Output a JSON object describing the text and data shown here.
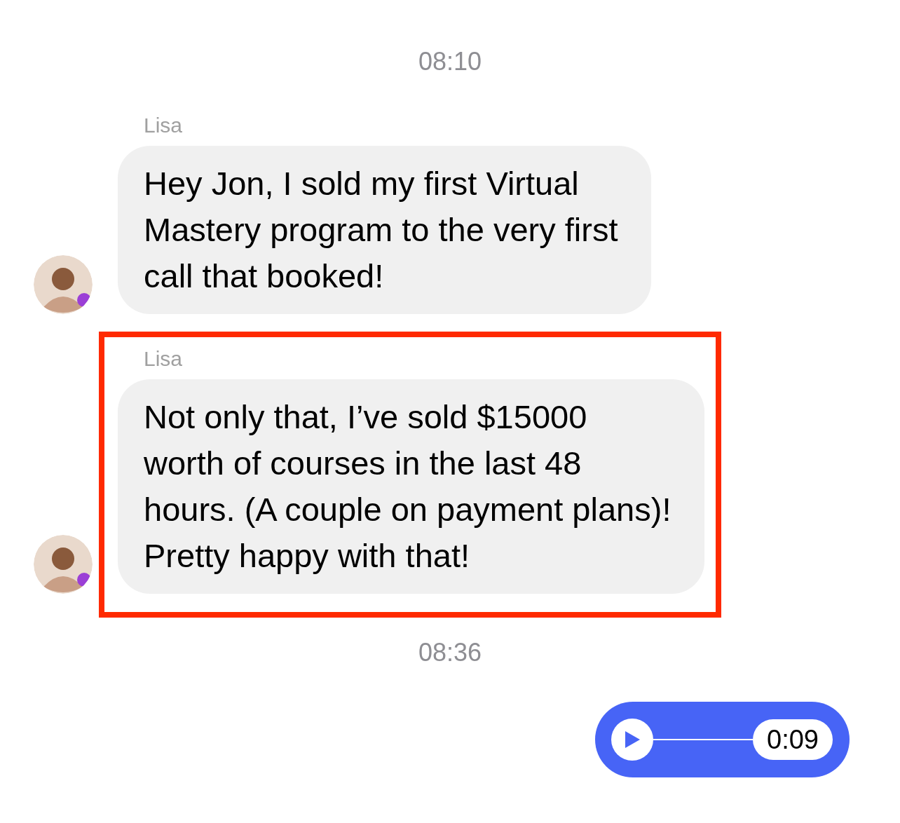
{
  "items": [
    {
      "kind": "timestamp",
      "text": "08:10"
    },
    {
      "kind": "incoming",
      "sender": "Lisa",
      "text": "Hey Jon, I sold my first Virtual\nMastery program to the very first\ncall that booked!",
      "highlighted": false
    },
    {
      "kind": "incoming",
      "sender": "Lisa",
      "text": "Not only that, I’ve sold $15000\nworth of courses in the last 48\nhours. (A couple on payment plans)!\nPretty happy with that!",
      "highlighted": true
    },
    {
      "kind": "timestamp",
      "text": "08:36"
    },
    {
      "kind": "voice",
      "duration": "0:09"
    }
  ]
}
